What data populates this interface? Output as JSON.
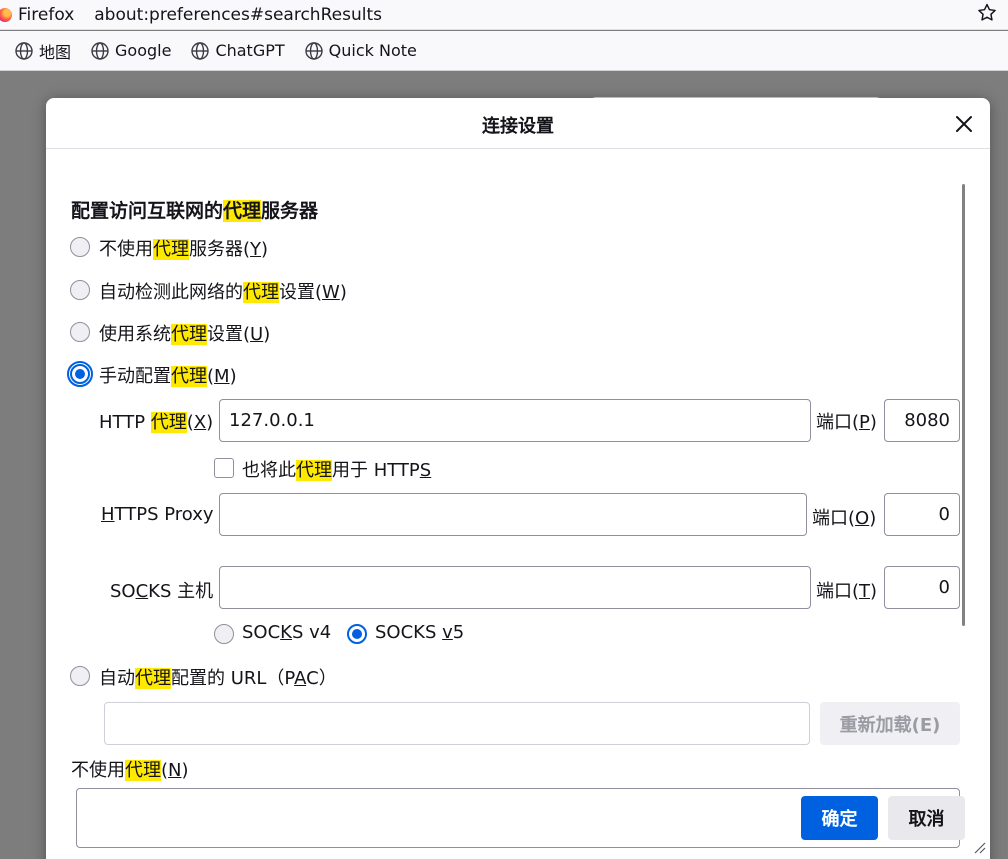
{
  "browser": {
    "name": "Firefox",
    "url": "about:preferences#searchResults",
    "star_icon": "star-icon",
    "bookmarks": [
      {
        "label": "地图",
        "icon": "globe-icon"
      },
      {
        "label": "Google",
        "icon": "globe-icon"
      },
      {
        "label": "ChatGPT",
        "icon": "globe-icon"
      },
      {
        "label": "Quick Note",
        "icon": "globe-icon"
      }
    ]
  },
  "dialog": {
    "title": "连接设置",
    "close_icon": "close-icon",
    "section_title": {
      "pre": "配置访问互联网的",
      "hl": "代理",
      "post": "服务器"
    },
    "options": {
      "no_proxy": {
        "pre": "不使用",
        "hl": "代理",
        "post": "服务器(",
        "key": "Y",
        "end": ")",
        "checked": false
      },
      "auto_detect": {
        "pre": "自动检测此网络的",
        "hl": "代理",
        "post": "设置(",
        "key": "W",
        "end": ")",
        "checked": false
      },
      "system": {
        "pre": "使用系统",
        "hl": "代理",
        "post": "设置(",
        "key": "U",
        "end": ")",
        "checked": false
      },
      "manual": {
        "pre": "手动配置",
        "hl": "代理",
        "post": "(",
        "key": "M",
        "end": ")",
        "checked": true
      },
      "pac": {
        "pre": "自动",
        "hl": "代理",
        "post": "配置的 URL（P",
        "key": "A",
        "end": "C）",
        "checked": false
      }
    },
    "http": {
      "label_pre": "HTTP ",
      "label_hl": "代理",
      "label_post": "(",
      "label_key": "X",
      "label_end": ")",
      "value": "127.0.0.1",
      "port_label_pre": "端口(",
      "port_key": "P",
      "port_end": ")",
      "port": "8080"
    },
    "also_https": {
      "pre": "也将此",
      "hl": "代理",
      "post": "用于 HTTP",
      "key": "S",
      "checked": false
    },
    "https": {
      "label_key": "H",
      "label_rest": "TTPS Proxy",
      "value": "",
      "port_label_pre": "端口(",
      "port_key": "O",
      "port_end": ")",
      "port": "0"
    },
    "socks": {
      "label_pre": "SO",
      "label_key": "C",
      "label_post": "KS 主机",
      "value": "",
      "port_label_pre": "端口(",
      "port_key": "T",
      "port_end": ")",
      "port": "0",
      "v4": {
        "pre": "SOC",
        "key": "K",
        "post": "S v4",
        "checked": false
      },
      "v5": {
        "pre": "SOCKS ",
        "key": "v",
        "post": "5",
        "checked": true
      }
    },
    "pac_url": "",
    "reload_label": "重新加载(E)",
    "bypass": {
      "pre": "不使用",
      "hl": "代理",
      "post": "(",
      "key": "N",
      "end": ")"
    },
    "ok_label": "确定",
    "cancel_label": "取消"
  },
  "colors": {
    "accent": "#0061e0",
    "highlight": "#ffe900",
    "overlay": "#7d7d7d"
  }
}
